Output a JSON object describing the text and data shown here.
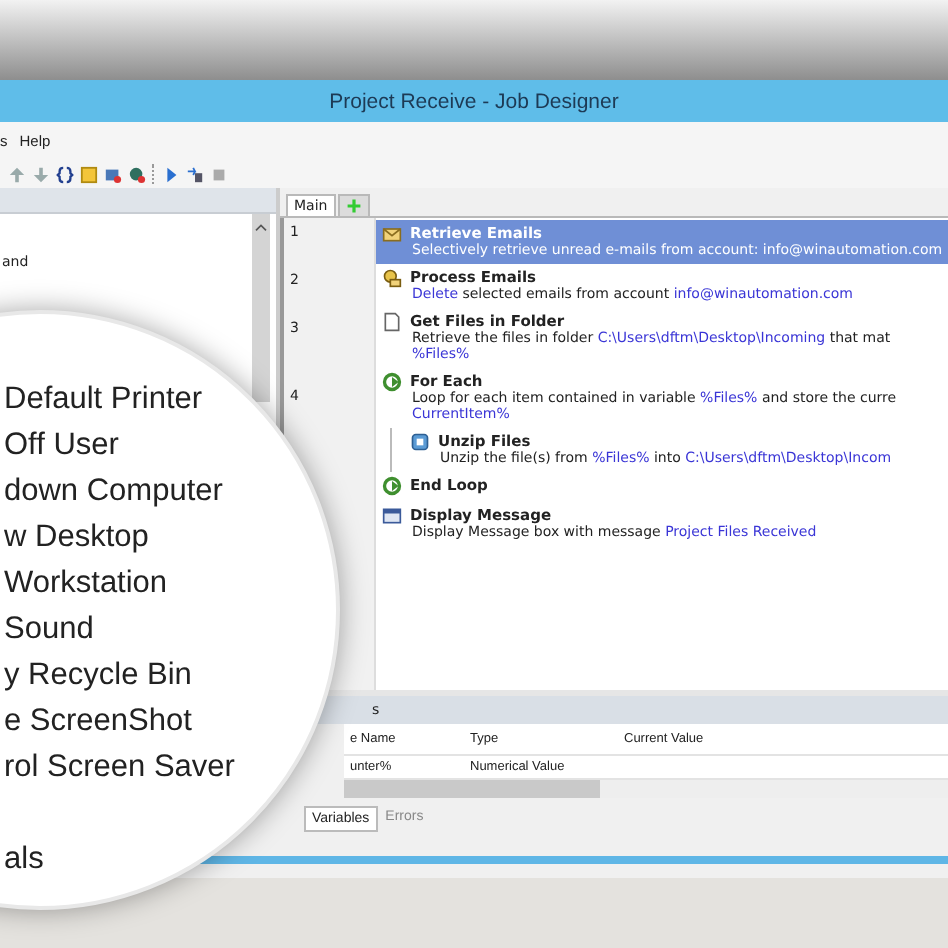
{
  "window": {
    "title": "Project Receive - Job Designer"
  },
  "menu": [
    {
      "label": "s"
    },
    {
      "label": "Help"
    }
  ],
  "actions_panel": {
    "items": [
      {
        "label": "and"
      }
    ]
  },
  "tabs": [
    {
      "label": "Main",
      "selected": true
    }
  ],
  "line_numbers": [
    "1",
    "2",
    "3",
    "4"
  ],
  "steps": [
    {
      "title": "Retrieve Emails",
      "kind": "email",
      "selected": true,
      "lines": [
        [
          {
            "text": "Selectively retrieve unread e-mails from account: info@winautomation.com",
            "kind": "plain"
          }
        ]
      ]
    },
    {
      "title": "Process Emails",
      "kind": "process",
      "selected": false,
      "lines": [
        [
          {
            "text": "Delete",
            "kind": "value"
          },
          {
            "text": " selected emails from account ",
            "kind": "plain"
          },
          {
            "text": "info@winautomation.com",
            "kind": "value"
          }
        ]
      ]
    },
    {
      "title": "Get Files in Folder",
      "kind": "file",
      "selected": false,
      "lines": [
        [
          {
            "text": "Retrieve the files in folder ",
            "kind": "plain"
          },
          {
            "text": "C:\\Users\\dftm\\Desktop\\Incoming",
            "kind": "value"
          },
          {
            "text": " that mat",
            "kind": "plain"
          }
        ],
        [
          {
            "text": "%Files%",
            "kind": "value"
          }
        ]
      ]
    },
    {
      "title": "For Each",
      "kind": "loop",
      "selected": false,
      "lines": [
        [
          {
            "text": "Loop for each item contained in variable ",
            "kind": "plain"
          },
          {
            "text": "%Files%",
            "kind": "value"
          },
          {
            "text": " and store the curre",
            "kind": "plain"
          }
        ],
        [
          {
            "text": "CurrentItem%",
            "kind": "value"
          }
        ]
      ],
      "children": [
        {
          "title": "Unzip Files",
          "kind": "unzip",
          "selected": false,
          "lines": [
            [
              {
                "text": "Unzip the file(s) from ",
                "kind": "plain"
              },
              {
                "text": "%Files%",
                "kind": "value"
              },
              {
                "text": " into ",
                "kind": "plain"
              },
              {
                "text": "C:\\Users\\dftm\\Desktop\\Incom",
                "kind": "value"
              }
            ]
          ]
        }
      ]
    },
    {
      "title": "End Loop",
      "kind": "endloop",
      "selected": false
    },
    {
      "title": "Display Message",
      "kind": "message",
      "selected": false,
      "lines": [
        [
          {
            "text": "Display Message box with message ",
            "kind": "plain"
          },
          {
            "text": "Project Files Received",
            "kind": "value"
          }
        ]
      ]
    }
  ],
  "magnifier": {
    "items": [
      "Default Printer",
      "Off User",
      "down Computer",
      "w Desktop",
      "Workstation",
      "Sound",
      "y Recycle Bin",
      "e ScreenShot",
      "rol Screen Saver",
      "als"
    ]
  },
  "variables_panel": {
    "title": "s",
    "columns": [
      "e Name",
      "Type",
      "Current Value"
    ],
    "rows": [
      [
        "unter%",
        "Numerical Value"
      ]
    ]
  },
  "bottom_tabs": [
    {
      "label": "Variables",
      "selected": true
    },
    {
      "label": "Errors",
      "selected": false
    }
  ]
}
